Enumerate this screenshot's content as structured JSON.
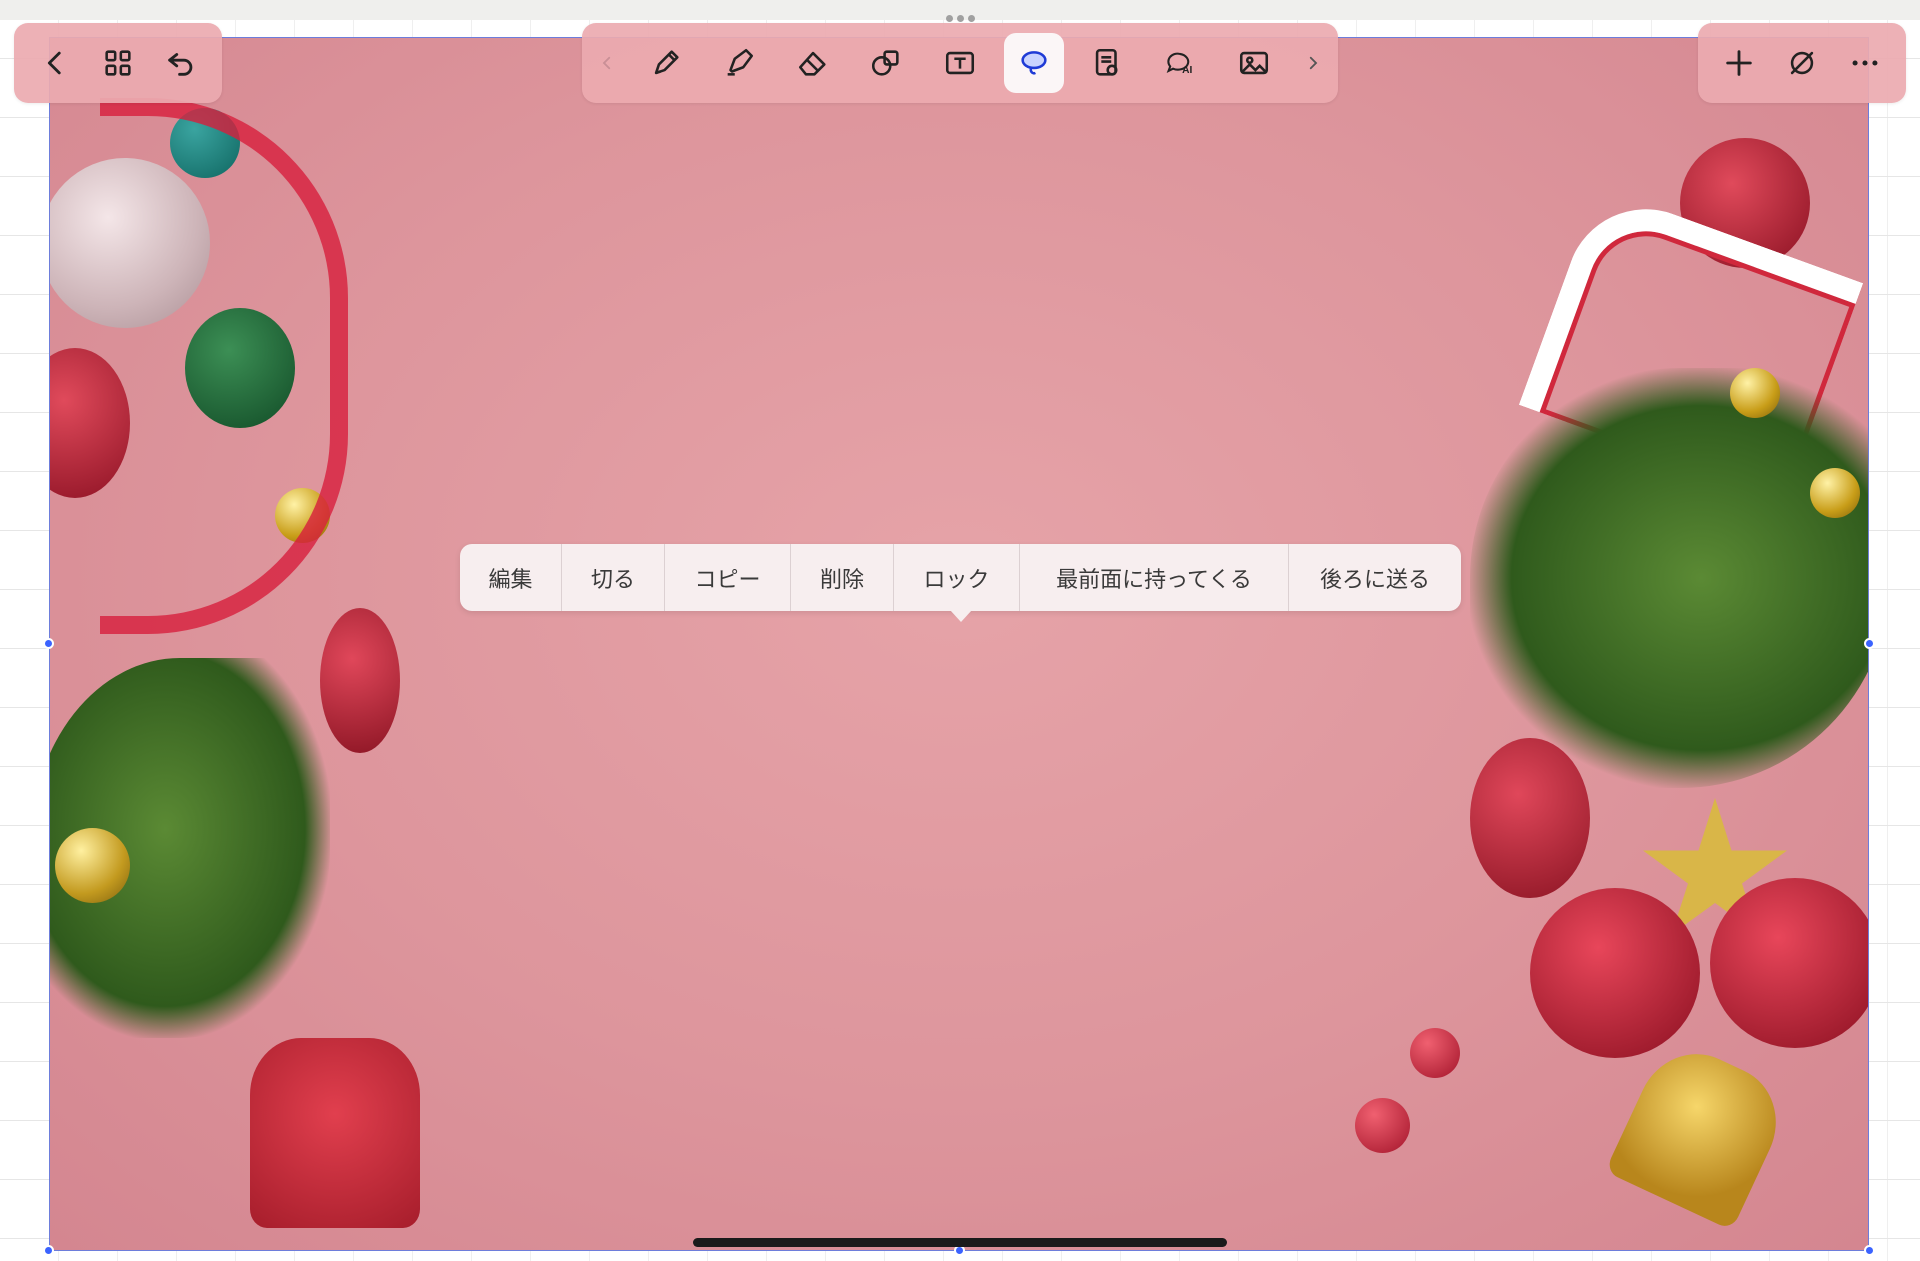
{
  "app": {
    "accent_color": "#3b63ff",
    "toolbar_color": "#ecaab0",
    "canvas_color": "#dd959c"
  },
  "toolbar_left": {
    "items": [
      {
        "icon": "chevron-left-icon"
      },
      {
        "icon": "grid-icon"
      },
      {
        "icon": "undo-icon"
      }
    ]
  },
  "toolbar_center": {
    "items": [
      {
        "icon": "chevron-left-icon"
      },
      {
        "icon": "pen-icon"
      },
      {
        "icon": "highlighter-icon"
      },
      {
        "icon": "eraser-icon"
      },
      {
        "icon": "shapes-icon"
      },
      {
        "icon": "text-box-icon"
      },
      {
        "icon": "lasso-icon",
        "active": true
      },
      {
        "icon": "sticker-icon"
      },
      {
        "icon": "ai-chat-icon",
        "label": "AI"
      },
      {
        "icon": "image-icon"
      },
      {
        "icon": "chevron-right-icon"
      }
    ]
  },
  "toolbar_right": {
    "items": [
      {
        "icon": "plus-icon"
      },
      {
        "icon": "no-edit-icon"
      },
      {
        "icon": "more-icon"
      }
    ]
  },
  "context_menu": {
    "items": [
      "編集",
      "切る",
      "コピー",
      "削除",
      "ロック",
      "最前面に持ってくる",
      "後ろに送る"
    ]
  }
}
